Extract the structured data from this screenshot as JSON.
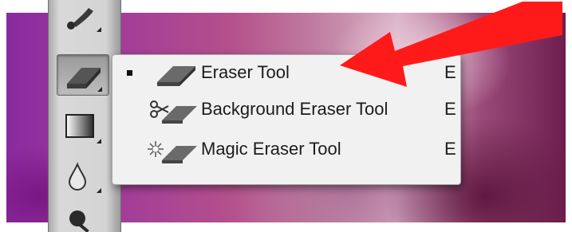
{
  "toolbar": {
    "tools": [
      {
        "icon": "brush-icon"
      },
      {
        "icon": "eraser-icon",
        "selected": true
      },
      {
        "icon": "gradient-icon"
      },
      {
        "icon": "blur-drop-icon"
      },
      {
        "icon": "dodge-icon"
      }
    ]
  },
  "flyout_menu": {
    "items": [
      {
        "label": "Eraser Tool",
        "shortcut": "E",
        "active": true,
        "icon": "eraser-icon"
      },
      {
        "label": "Background Eraser Tool",
        "shortcut": "E",
        "active": false,
        "icon": "background-eraser-icon"
      },
      {
        "label": "Magic Eraser Tool",
        "shortcut": "E",
        "active": false,
        "icon": "magic-eraser-icon"
      }
    ]
  },
  "annotation": {
    "icon": "red-arrow-icon",
    "color": "#ff1a1a"
  }
}
